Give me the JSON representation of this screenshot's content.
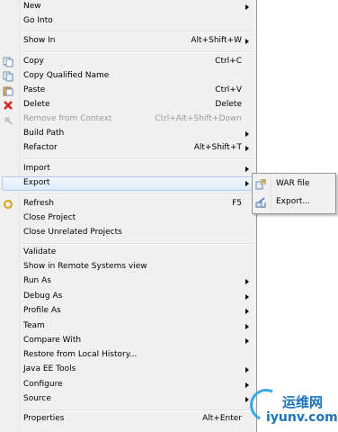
{
  "menu": {
    "items": [
      {
        "label": "New",
        "shortcut": "",
        "submenu": true,
        "icon": ""
      },
      {
        "label": "Go Into",
        "shortcut": "",
        "submenu": false,
        "icon": ""
      },
      {
        "label": "Show In",
        "shortcut": "Alt+Shift+W",
        "submenu": true,
        "icon": ""
      },
      {
        "label": "Copy",
        "shortcut": "Ctrl+C",
        "submenu": false,
        "icon": "copy-icon"
      },
      {
        "label": "Copy Qualified Name",
        "shortcut": "",
        "submenu": false,
        "icon": "copy-qualified-icon"
      },
      {
        "label": "Paste",
        "shortcut": "Ctrl+V",
        "submenu": false,
        "icon": "paste-icon"
      },
      {
        "label": "Delete",
        "shortcut": "Delete",
        "submenu": false,
        "icon": "delete-icon"
      },
      {
        "label": "Remove from Context",
        "shortcut": "Ctrl+Alt+Shift+Down",
        "submenu": false,
        "icon": "remove-context-icon",
        "disabled": true
      },
      {
        "label": "Build Path",
        "shortcut": "",
        "submenu": true,
        "icon": ""
      },
      {
        "label": "Refactor",
        "shortcut": "Alt+Shift+T",
        "submenu": true,
        "icon": ""
      },
      {
        "label": "Import",
        "shortcut": "",
        "submenu": true,
        "icon": ""
      },
      {
        "label": "Export",
        "shortcut": "",
        "submenu": true,
        "icon": "",
        "highlighted": true
      },
      {
        "label": "Refresh",
        "shortcut": "F5",
        "submenu": false,
        "icon": "refresh-icon"
      },
      {
        "label": "Close Project",
        "shortcut": "",
        "submenu": false,
        "icon": ""
      },
      {
        "label": "Close Unrelated Projects",
        "shortcut": "",
        "submenu": false,
        "icon": ""
      },
      {
        "label": "Validate",
        "shortcut": "",
        "submenu": false,
        "icon": ""
      },
      {
        "label": "Show in Remote Systems view",
        "shortcut": "",
        "submenu": false,
        "icon": ""
      },
      {
        "label": "Run As",
        "shortcut": "",
        "submenu": true,
        "icon": ""
      },
      {
        "label": "Debug As",
        "shortcut": "",
        "submenu": true,
        "icon": ""
      },
      {
        "label": "Profile As",
        "shortcut": "",
        "submenu": true,
        "icon": ""
      },
      {
        "label": "Team",
        "shortcut": "",
        "submenu": true,
        "icon": ""
      },
      {
        "label": "Compare With",
        "shortcut": "",
        "submenu": true,
        "icon": ""
      },
      {
        "label": "Restore from Local History...",
        "shortcut": "",
        "submenu": false,
        "icon": ""
      },
      {
        "label": "Java EE Tools",
        "shortcut": "",
        "submenu": true,
        "icon": ""
      },
      {
        "label": "Configure",
        "shortcut": "",
        "submenu": true,
        "icon": ""
      },
      {
        "label": "Source",
        "shortcut": "",
        "submenu": true,
        "icon": ""
      },
      {
        "label": "Properties",
        "shortcut": "Alt+Enter",
        "submenu": false,
        "icon": ""
      }
    ]
  },
  "export_submenu": {
    "items": [
      {
        "label": "WAR file",
        "icon": "war-file-icon"
      },
      {
        "label": "Export...",
        "icon": "export-wizard-icon"
      }
    ]
  },
  "watermark": {
    "line1": "运维网",
    "line2": "iyunv.com"
  },
  "colors": {
    "highlight_border": "#aecff7",
    "highlight_fill": "#dcebfc",
    "menu_bg": "#f0f0f0",
    "disabled_text": "#9a9a9a",
    "watermark": "#1d74b8"
  }
}
